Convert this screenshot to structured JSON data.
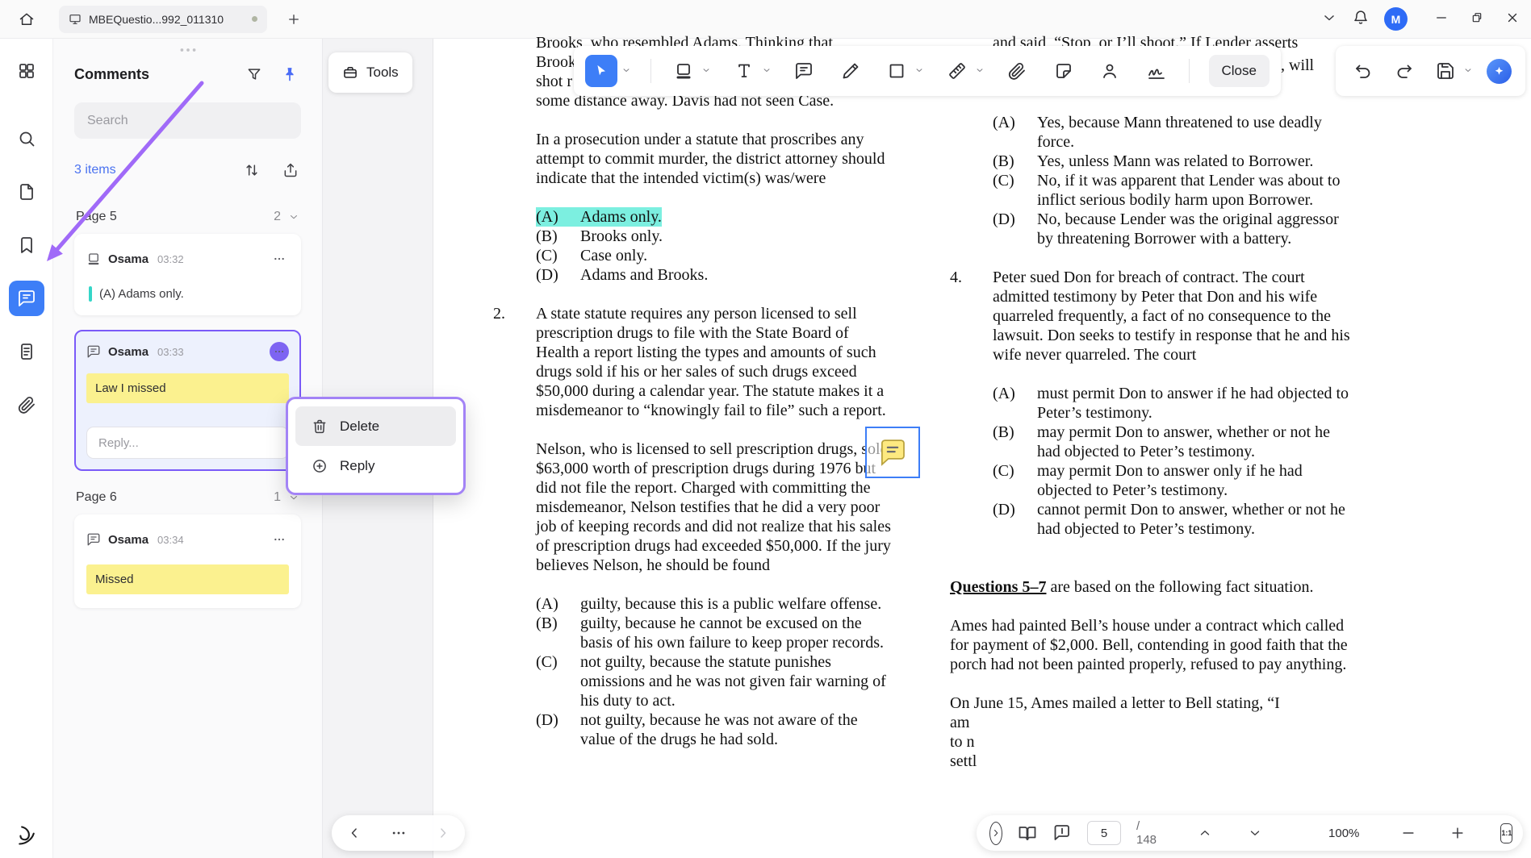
{
  "window": {
    "tab_title": "MBEQuestio...992_011310",
    "avatar_initial": "M"
  },
  "comments_panel": {
    "title": "Comments",
    "search_placeholder": "Search",
    "items_count": "3 items",
    "page5": {
      "label": "Page 5",
      "count": "2"
    },
    "page6": {
      "label": "Page 6",
      "count": "1"
    },
    "cards": [
      {
        "author": "Osama",
        "time": "03:32",
        "body": "(A)  Adams only."
      },
      {
        "author": "Osama",
        "time": "03:33",
        "body": "Law I missed",
        "reply_placeholder": "Reply..."
      },
      {
        "author": "Osama",
        "time": "03:34",
        "body": "Missed"
      }
    ],
    "menu": {
      "delete_label": "Delete",
      "reply_label": "Reply"
    }
  },
  "toolbar": {
    "tools_label": "Tools",
    "close_label": "Close"
  },
  "statusbar": {
    "page_value": "5",
    "page_total": "/ 148",
    "zoom_level": "100%",
    "fit_label": "1:1"
  },
  "document": {
    "left": {
      "top_lines": [
        "Brooks, who resembled Adams. Thinking that",
        "Brook",
        "shot r",
        "some distance away. Davis had not seen Case."
      ],
      "q1_stem": "In a prosecution under a statute that proscribes any attempt to commit murder, the district attorney should indicate that the intended victim(s) was/were",
      "q1_options": [
        {
          "letter": "(A)",
          "text": "Adams only."
        },
        {
          "letter": "(B)",
          "text": "Brooks only."
        },
        {
          "letter": "(C)",
          "text": "Case only."
        },
        {
          "letter": "(D)",
          "text": "Adams and Brooks."
        }
      ],
      "q2_number": "2.",
      "q2_para1": "A state statute requires any person licensed to sell prescription drugs to file with the State Board of Health a report listing the types and amounts of such drugs sold if his or her sales of such drugs exceed $50,000 during a calendar year. The statute makes it a misdemeanor to “knowingly fail to file” such a report.",
      "q2_para2": "Nelson, who is licensed to sell prescription drugs, sold $63,000 worth of prescription drugs during 1976 but did not file the report. Charged with committing the misdemeanor, Nelson testifies that he did a very poor job of keeping records and did not realize that his sales of prescription drugs had exceeded $50,000. If the jury believes Nelson, he should be found",
      "q2_options": [
        {
          "letter": "(A)",
          "text": "guilty, because this is a public welfare offense."
        },
        {
          "letter": "(B)",
          "text": "guilty, because he cannot be excused on the basis of his own failure to keep proper records."
        },
        {
          "letter": "(C)",
          "text": "not guilty, because the statute punishes omissions and he was not given fair warning of his duty to act."
        },
        {
          "letter": "(D)",
          "text": "not guilty, because he was not aware of the value of the drugs he had sold."
        }
      ]
    },
    "right": {
      "frag1": "and said, “Stop, or I’ll shoot.” If Lender asserts",
      "frag2": ", will",
      "q3_options": [
        {
          "letter": "(A)",
          "text": "Yes, because Mann threatened to use deadly force."
        },
        {
          "letter": "(B)",
          "text": "Yes, unless Mann was related to Borrower."
        },
        {
          "letter": "(C)",
          "text": "No, if it was apparent that Lender was about to inflict serious bodily harm upon Borrower."
        },
        {
          "letter": "(D)",
          "text": "No, because Lender was the original aggressor by threatening Borrower with a battery."
        }
      ],
      "q4_number": "4.",
      "q4_stem": "Peter sued Don for breach of contract. The court admitted testimony by Peter that Don and his wife quarreled frequently, a fact of no consequence to the lawsuit. Don seeks to testify in response that he and his wife never quarreled. The court",
      "q4_options": [
        {
          "letter": "(A)",
          "text": "must permit Don to answer if he had objected to Peter’s testimony."
        },
        {
          "letter": "(B)",
          "text": "may permit Don to answer, whether or not he had objected to Peter’s testimony."
        },
        {
          "letter": "(C)",
          "text": "may permit Don to answer only if he had objected to Peter’s testimony."
        },
        {
          "letter": "(D)",
          "text": "cannot permit Don to answer, whether or not he had objected to Peter’s testimony."
        }
      ],
      "q57_label": "Questions 5–7",
      "q57_text": " are based on the following fact situation.",
      "para_ames": "Ames had painted Bell’s house under a contract which called for payment of $2,000. Bell, contending in good faith that the porch had not been painted properly, refused to pay anything.",
      "para_june_l1": "On June 15, Ames mailed a letter to Bell stating, “I",
      "para_june_l2": "am",
      "para_june_l3": "to n",
      "para_june_l4": "settl"
    }
  },
  "colors": {
    "accent_blue": "#3D7EF7",
    "annotation_purple": "#A06AF8",
    "highlight_yellow": "#FBF18F",
    "highlight_teal": "#7CEFE0"
  }
}
